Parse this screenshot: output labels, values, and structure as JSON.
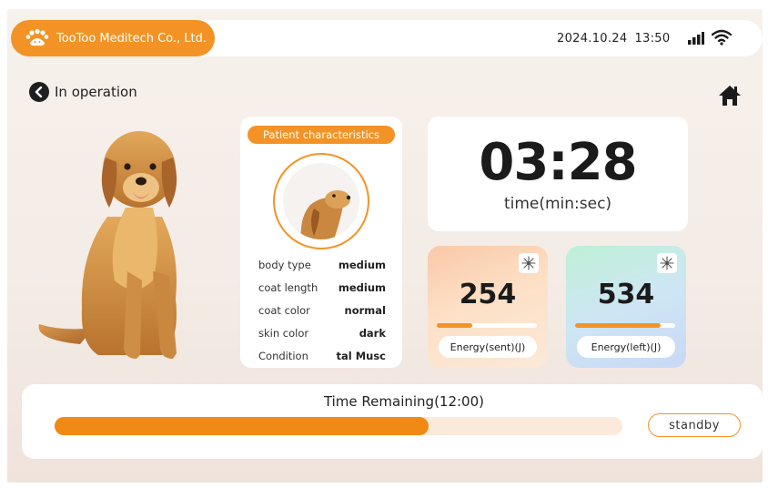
{
  "header": {
    "company": "TooToo Meditech Co., Ltd.",
    "date": "2024.10.24",
    "time": "13:50",
    "signal_icon": "signal-bars-icon",
    "wifi_icon": "wifi-icon"
  },
  "status": {
    "label": "In operation",
    "back_icon": "chevron-left-icon",
    "home_icon": "home-icon"
  },
  "patient": {
    "title": "Patient characteristics",
    "attributes": [
      {
        "key": "body type",
        "value": "medium"
      },
      {
        "key": "coat length",
        "value": "medium"
      },
      {
        "key": "coat color",
        "value": "normal"
      },
      {
        "key": "skin color",
        "value": "dark"
      },
      {
        "key": "Condition",
        "value": "tal  Musc"
      }
    ]
  },
  "timer": {
    "value": "03:28",
    "unit": "time(min:sec)"
  },
  "energy": {
    "sent": {
      "value": "254",
      "label": "Energy(sent)(J)",
      "progress": 0.35
    },
    "left": {
      "value": "534",
      "label": "Energy(left)(J)",
      "progress": 0.85
    }
  },
  "session": {
    "title": "Time Remaining(12:00)",
    "progress": 0.659,
    "status_button": "standby"
  },
  "colors": {
    "accent": "#f39325",
    "progress": "#f08a14"
  }
}
